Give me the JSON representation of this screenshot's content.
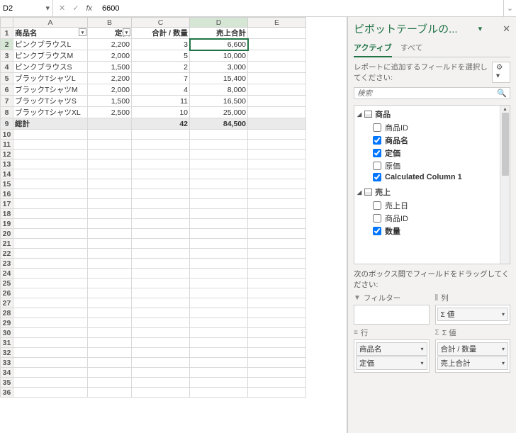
{
  "formula_bar": {
    "cell_ref": "D2",
    "fx_label": "fx",
    "value": "6600"
  },
  "columns": [
    "",
    "A",
    "B",
    "C",
    "D",
    "E"
  ],
  "header_row": [
    "商品名",
    "定価",
    "合計 / 数量",
    "売上合計"
  ],
  "rows": [
    {
      "n": "2",
      "a": "ピンクブラウスL",
      "b": "2,200",
      "c": "3",
      "d": "6,600"
    },
    {
      "n": "3",
      "a": "ピンクブラウスM",
      "b": "2,000",
      "c": "5",
      "d": "10,000"
    },
    {
      "n": "4",
      "a": "ピンクブラウスS",
      "b": "1,500",
      "c": "2",
      "d": "3,000"
    },
    {
      "n": "5",
      "a": "ブラックTシャツL",
      "b": "2,200",
      "c": "7",
      "d": "15,400"
    },
    {
      "n": "6",
      "a": "ブラックTシャツM",
      "b": "2,000",
      "c": "4",
      "d": "8,000"
    },
    {
      "n": "7",
      "a": "ブラックTシャツS",
      "b": "1,500",
      "c": "11",
      "d": "16,500"
    },
    {
      "n": "8",
      "a": "ブラックTシャツXL",
      "b": "2,500",
      "c": "10",
      "d": "25,000"
    }
  ],
  "total_row": {
    "n": "9",
    "a": "総計",
    "c": "42",
    "d": "84,500"
  },
  "blank_rows": [
    "10",
    "11",
    "12",
    "13",
    "14",
    "15",
    "16",
    "17",
    "18",
    "19",
    "20",
    "21",
    "22",
    "23",
    "24",
    "25",
    "26",
    "27",
    "28",
    "29",
    "30",
    "31",
    "32",
    "33",
    "34",
    "35",
    "36"
  ],
  "pivot": {
    "title": "ピボットテーブルの...",
    "tabs": {
      "active": "アクティブ",
      "all": "すべて"
    },
    "desc": "レポートに追加するフィールドを選択してください:",
    "search_placeholder": "検索",
    "groups": [
      {
        "name": "商品",
        "fields": [
          {
            "label": "商品ID",
            "checked": false
          },
          {
            "label": "商品名",
            "checked": true
          },
          {
            "label": "定価",
            "checked": true
          },
          {
            "label": "原価",
            "checked": false
          },
          {
            "label": "Calculated Column 1",
            "checked": true
          }
        ]
      },
      {
        "name": "売上",
        "fields": [
          {
            "label": "売上日",
            "checked": false
          },
          {
            "label": "商品ID",
            "checked": false
          },
          {
            "label": "数量",
            "checked": true
          }
        ]
      }
    ],
    "areas_label": "次のボックス間でフィールドをドラッグしてください:",
    "areas": {
      "filter": {
        "title": "フィルター",
        "items": []
      },
      "cols": {
        "title": "列",
        "items": [
          "Σ 値"
        ]
      },
      "rows": {
        "title": "行",
        "items": [
          "商品名",
          "定価"
        ]
      },
      "vals": {
        "title": "Σ 値",
        "items": [
          "合計 / 数量",
          "売上合計"
        ]
      }
    }
  }
}
